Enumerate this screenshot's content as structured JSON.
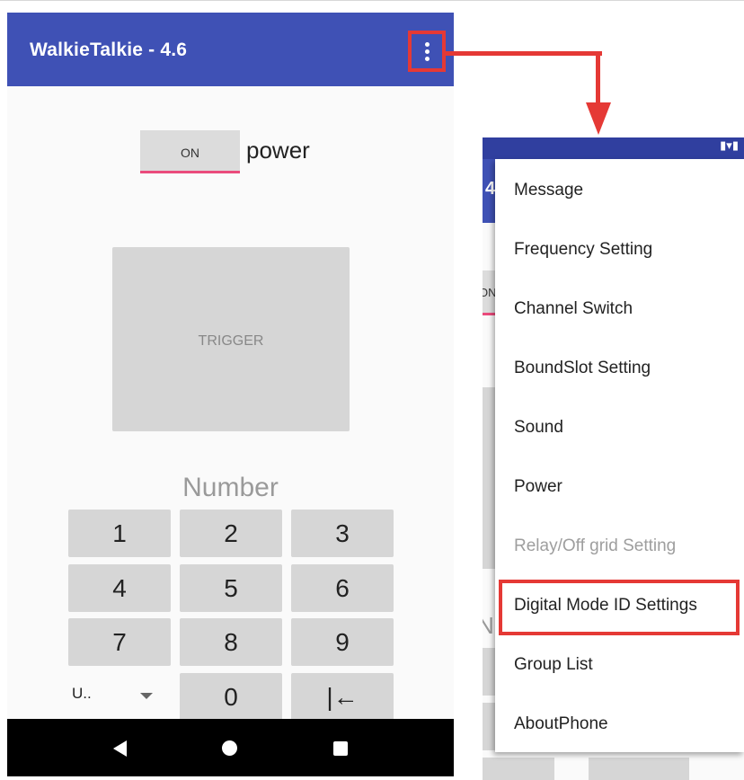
{
  "left_phone": {
    "app_title": "WalkieTalkie - 4.6",
    "power_toggle": {
      "label": "ON",
      "description": "power"
    },
    "trigger_button": "TRIGGER",
    "number_label": "Number",
    "keypad": {
      "row1": [
        "1",
        "2",
        "3"
      ],
      "row2": [
        "4",
        "5",
        "6"
      ],
      "row3": [
        "7",
        "8",
        "9"
      ],
      "row4": {
        "dropdown_value": "U..",
        "zero": "0",
        "backspace": "|←"
      }
    },
    "nav": [
      "back-icon",
      "home-icon",
      "recents-icon"
    ]
  },
  "right_phone": {
    "title_fragment": "4",
    "toggle_fragment": "ON",
    "number_fragment": "N",
    "status_icons": "▮▾▮",
    "menu_items": [
      {
        "label": "Message",
        "enabled": true
      },
      {
        "label": "Frequency Setting",
        "enabled": true
      },
      {
        "label": "Channel Switch",
        "enabled": true
      },
      {
        "label": "BoundSlot Setting",
        "enabled": true
      },
      {
        "label": "Sound",
        "enabled": true
      },
      {
        "label": "Power",
        "enabled": true
      },
      {
        "label": "Relay/Off grid Setting",
        "enabled": false
      },
      {
        "label": "Digital Mode ID Settings",
        "enabled": true,
        "highlighted": true
      },
      {
        "label": "Group List",
        "enabled": true
      },
      {
        "label": "AboutPhone",
        "enabled": true
      }
    ]
  },
  "colors": {
    "app_bar": "#3f51b5",
    "status_bar": "#303f9f",
    "accent": "#ea4b7c",
    "callout": "#e53935"
  }
}
